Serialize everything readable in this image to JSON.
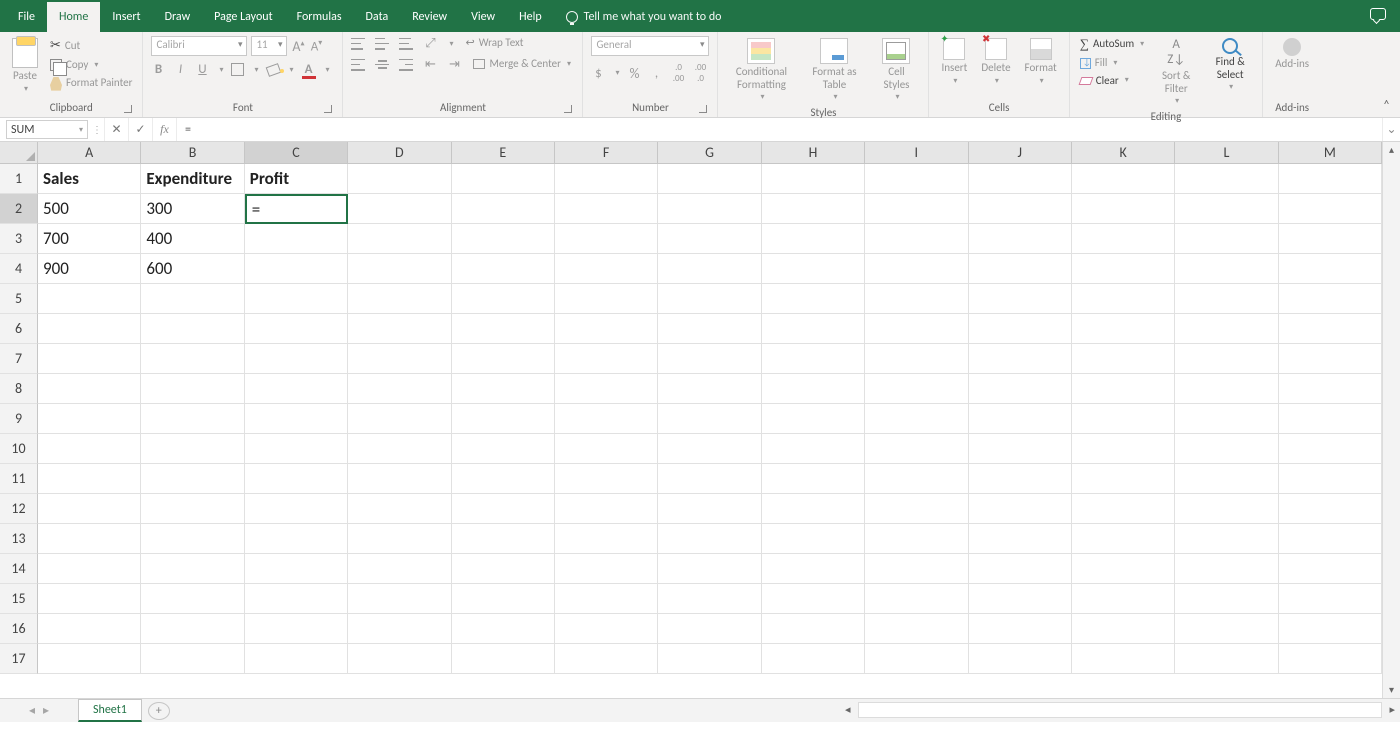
{
  "tabs": {
    "file": "File",
    "home": "Home",
    "insert": "Insert",
    "draw": "Draw",
    "page_layout": "Page Layout",
    "formulas": "Formulas",
    "data": "Data",
    "review": "Review",
    "view": "View",
    "help": "Help",
    "tell_me": "Tell me what you want to do"
  },
  "ribbon": {
    "clipboard": {
      "label": "Clipboard",
      "paste": "Paste",
      "cut": "Cut",
      "copy": "Copy",
      "painter": "Format Painter"
    },
    "font": {
      "label": "Font",
      "name": "Calibri",
      "size": "11",
      "bold": "B",
      "italic": "I",
      "underline": "U",
      "color": "A"
    },
    "alignment": {
      "label": "Alignment",
      "wrap": "Wrap Text",
      "merge": "Merge & Center"
    },
    "number": {
      "label": "Number",
      "format": "General",
      "pct": "%",
      "comma": ",",
      "inc": ".0 .00",
      "dec": ".00 .0"
    },
    "styles": {
      "label": "Styles",
      "cond": "Conditional Formatting",
      "table": "Format as Table",
      "cell": "Cell Styles"
    },
    "cells": {
      "label": "Cells",
      "insert": "Insert",
      "delete": "Delete",
      "format": "Format"
    },
    "editing": {
      "label": "Editing",
      "autosum": "AutoSum",
      "fill": "Fill",
      "clear": "Clear",
      "sort": "Sort & Filter",
      "find": "Find & Select"
    },
    "addins": {
      "label": "Add-ins",
      "addins": "Add-ins"
    }
  },
  "formula_bar": {
    "namebox": "SUM",
    "formula": "="
  },
  "grid": {
    "columns": [
      "A",
      "B",
      "C",
      "D",
      "E",
      "F",
      "G",
      "H",
      "I",
      "J",
      "K",
      "L",
      "M"
    ],
    "rows": [
      "1",
      "2",
      "3",
      "4",
      "5",
      "6",
      "7",
      "8",
      "9",
      "10",
      "11",
      "12",
      "13",
      "14",
      "15",
      "16",
      "17"
    ],
    "active_col": "C",
    "active_row": "2",
    "data": {
      "A1": "Sales",
      "B1": "Expenditure",
      "C1": "Profit",
      "A2": "500",
      "B2": "300",
      "C2": "=",
      "A3": "700",
      "B3": "400",
      "A4": "900",
      "B4": "600"
    }
  },
  "sheetbar": {
    "sheet": "Sheet1",
    "new": "+"
  }
}
